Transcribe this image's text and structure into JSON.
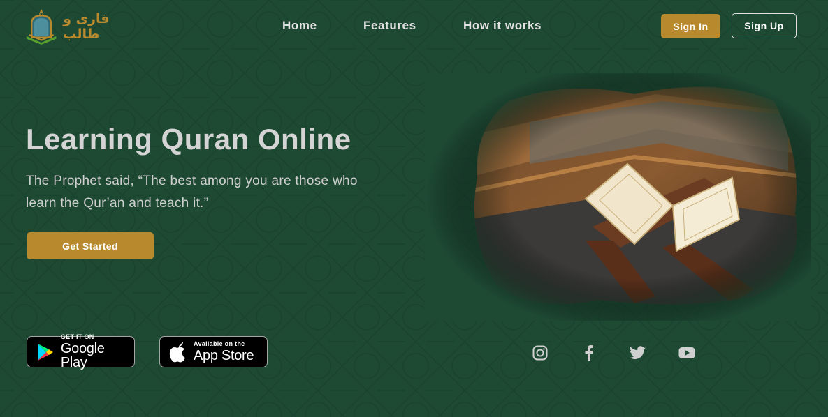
{
  "brand": {
    "name": "قاری و طالب"
  },
  "nav": {
    "home": "Home",
    "features": "Features",
    "how_it_works": "How it works"
  },
  "auth": {
    "sign_in": "Sign In",
    "sign_up": "Sign Up"
  },
  "hero": {
    "title": "Learning Quran Online",
    "quote": "The Prophet said, “The best among you are those who learn the Qur’an and teach it.”",
    "cta": "Get Started"
  },
  "stores": {
    "google_play": {
      "small": "GET IT ON",
      "big": "Google Play"
    },
    "app_store": {
      "small": "Available on the",
      "big": "App Store"
    }
  },
  "social": [
    "instagram-icon",
    "facebook-icon",
    "twitter-icon",
    "youtube-icon"
  ],
  "colors": {
    "background": "#1e4a34",
    "accent": "#b8892d",
    "text": "#d4d4d4"
  }
}
